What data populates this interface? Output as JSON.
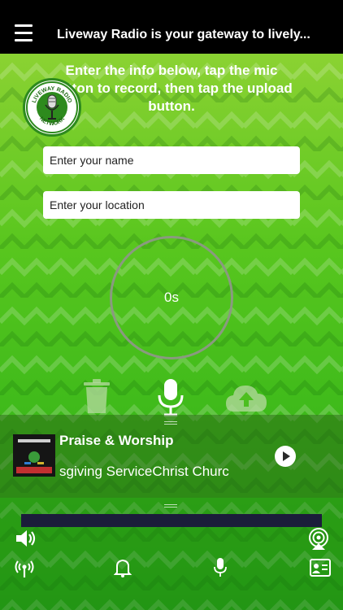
{
  "header": {
    "title": "Liveway Radio is your gateway to lively..."
  },
  "instructions": "Enter the info below, tap the mic button to record, then tap the upload button.",
  "logo": {
    "top_text": "LIVEWAY RADIO",
    "bottom_text": "NETWORK"
  },
  "form": {
    "name_placeholder": "Enter your name",
    "location_placeholder": "Enter your location"
  },
  "recorder": {
    "timer": "0s"
  },
  "player": {
    "track_title": "Praise & Worship",
    "track_subtitle": "sgiving ServiceChrist Churc",
    "progress": 0
  },
  "colors": {
    "background_top": "#8bd232",
    "background_bottom": "#26a617",
    "topbar": "#000000",
    "progress_bar": "#1b1d3a"
  },
  "icons": {
    "menu": "hamburger-icon",
    "delete": "trash-icon",
    "mic": "microphone-icon",
    "upload": "cloud-upload-icon",
    "play": "play-icon",
    "volume": "volume-icon",
    "airplay": "airplay-icon",
    "tab1": "podcast-icon",
    "tab2": "bell-icon",
    "tab3": "microphone-icon",
    "tab4": "contact-card-icon"
  }
}
